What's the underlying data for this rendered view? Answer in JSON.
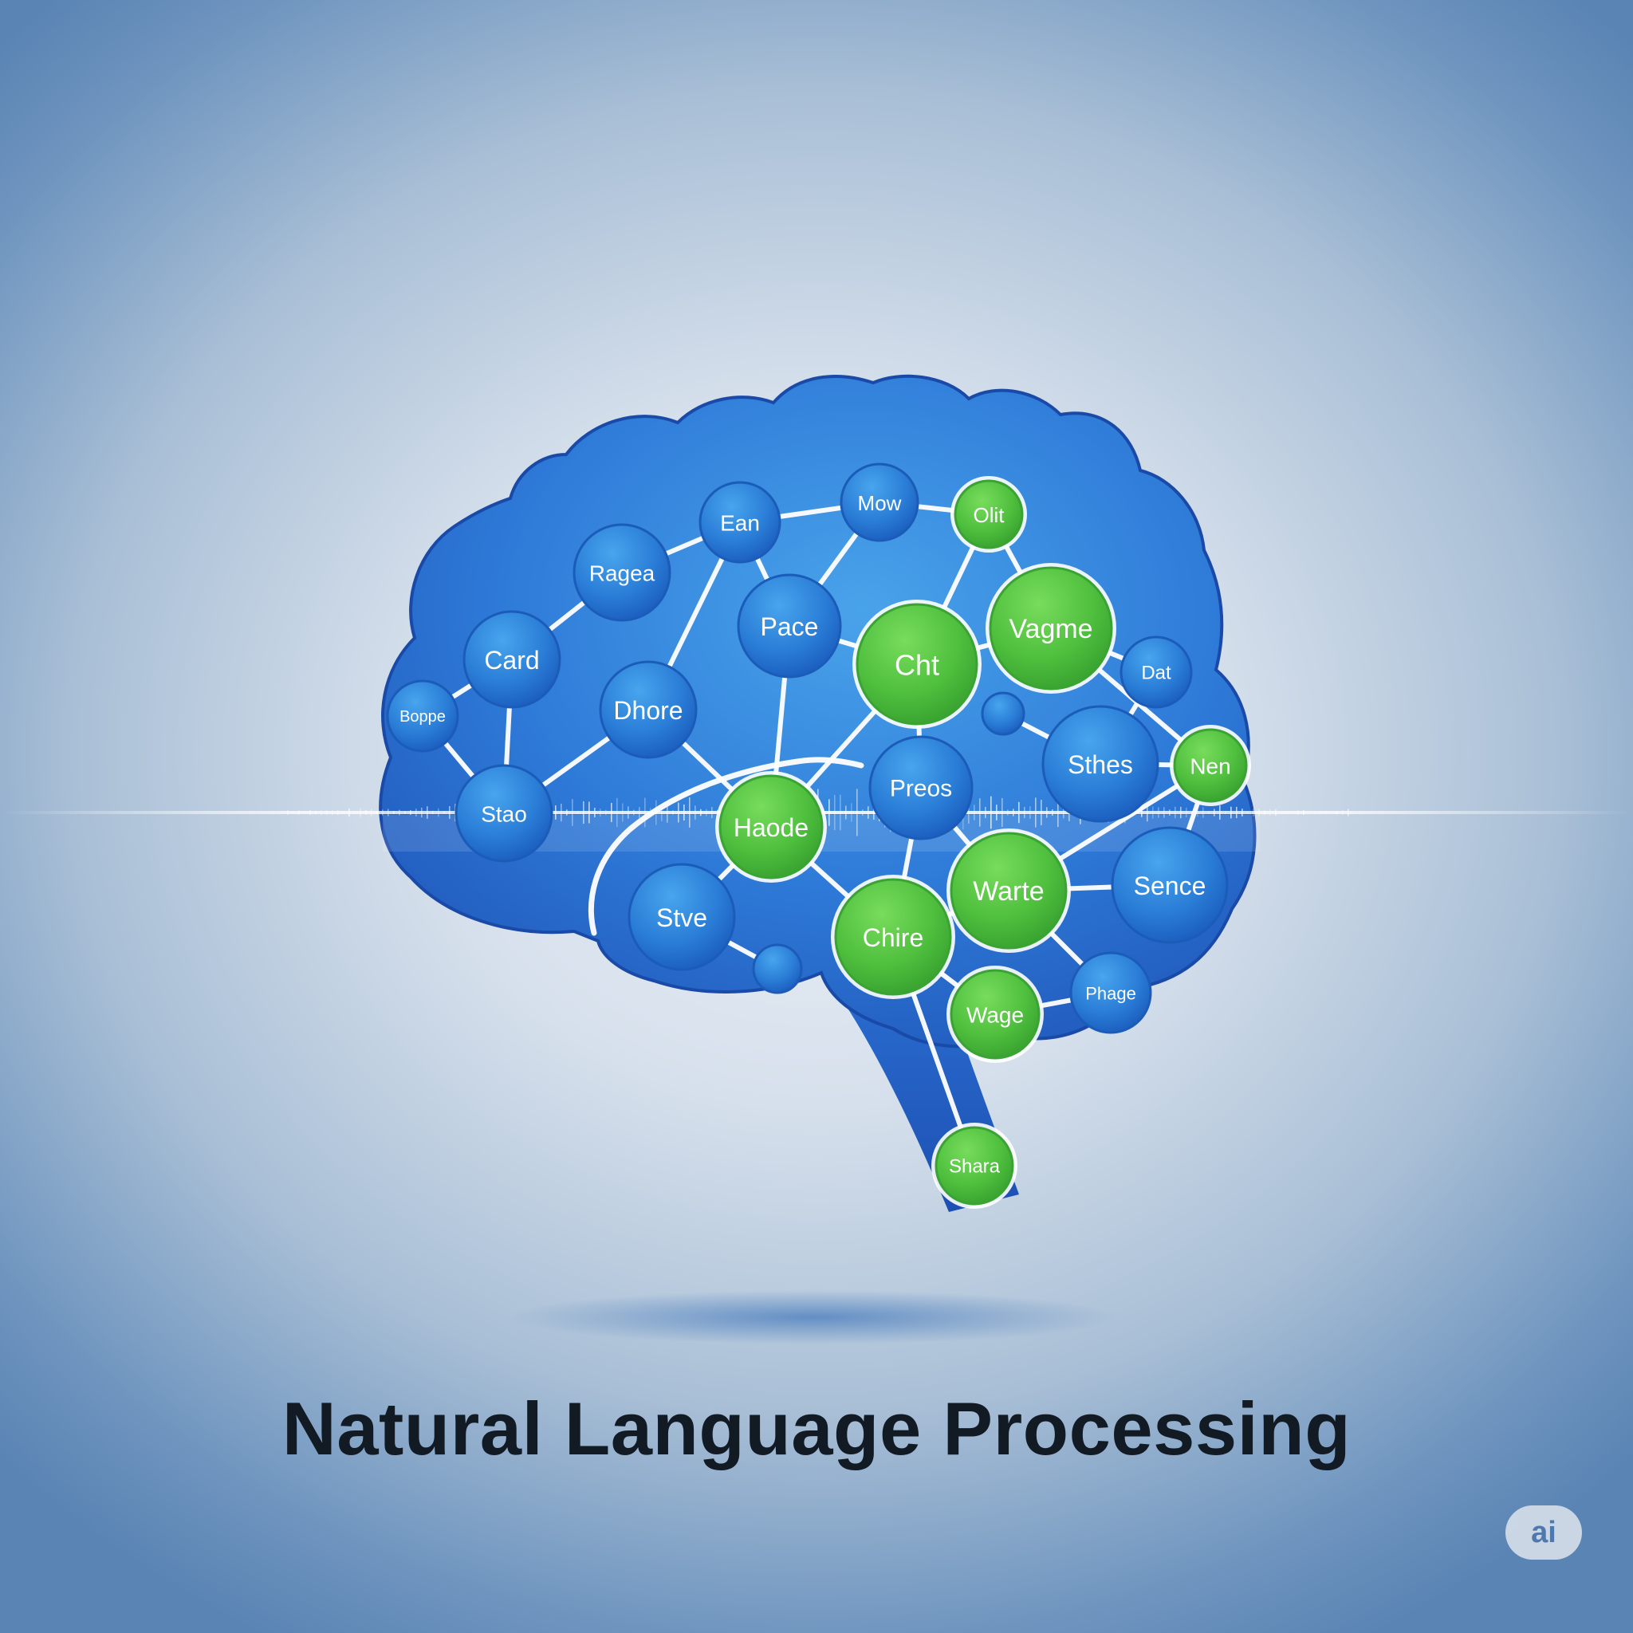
{
  "caption": "Natural Language Processing",
  "badge": "ai",
  "colors": {
    "brain": "#2a73d6",
    "brain_dark": "#1e56b8",
    "node_blue": "#2a7fd8",
    "node_green": "#4fc03f",
    "link": "#ffffff",
    "caption": "#121a24"
  },
  "nodes": [
    {
      "id": "ean",
      "label": "Ean",
      "color": "blue"
    },
    {
      "id": "mow",
      "label": "Mow",
      "color": "blue"
    },
    {
      "id": "olit",
      "label": "Olit",
      "color": "green"
    },
    {
      "id": "ragea",
      "label": "Ragea",
      "color": "blue"
    },
    {
      "id": "pace",
      "label": "Pace",
      "color": "blue"
    },
    {
      "id": "vagme",
      "label": "Vagme",
      "color": "green"
    },
    {
      "id": "card",
      "label": "Card",
      "color": "blue"
    },
    {
      "id": "cht",
      "label": "Cht",
      "color": "green"
    },
    {
      "id": "dat",
      "label": "Dat",
      "color": "blue"
    },
    {
      "id": "boppe",
      "label": "Boppe",
      "color": "blue"
    },
    {
      "id": "dhore",
      "label": "Dhore",
      "color": "blue"
    },
    {
      "id": "small1",
      "label": "",
      "color": "blue"
    },
    {
      "id": "sthes",
      "label": "Sthes",
      "color": "blue"
    },
    {
      "id": "nen",
      "label": "Nen",
      "color": "green"
    },
    {
      "id": "stao",
      "label": "Stao",
      "color": "blue"
    },
    {
      "id": "preos",
      "label": "Preos",
      "color": "blue"
    },
    {
      "id": "haode",
      "label": "Haode",
      "color": "green"
    },
    {
      "id": "warte",
      "label": "Warte",
      "color": "green"
    },
    {
      "id": "sence",
      "label": "Sence",
      "color": "blue"
    },
    {
      "id": "stve",
      "label": "Stve",
      "color": "blue"
    },
    {
      "id": "chire",
      "label": "Chire",
      "color": "green"
    },
    {
      "id": "small2",
      "label": "",
      "color": "blue"
    },
    {
      "id": "phage",
      "label": "Phage",
      "color": "blue"
    },
    {
      "id": "wage",
      "label": "Wage",
      "color": "green"
    },
    {
      "id": "shara",
      "label": "Shara",
      "color": "green"
    }
  ],
  "links": [
    [
      "boppe",
      "card"
    ],
    [
      "card",
      "ragea"
    ],
    [
      "ragea",
      "ean"
    ],
    [
      "ean",
      "mow"
    ],
    [
      "mow",
      "olit"
    ],
    [
      "ean",
      "pace"
    ],
    [
      "ean",
      "dhore"
    ],
    [
      "mow",
      "pace"
    ],
    [
      "olit",
      "vagme"
    ],
    [
      "olit",
      "cht"
    ],
    [
      "pace",
      "cht"
    ],
    [
      "cht",
      "vagme"
    ],
    [
      "vagme",
      "dat"
    ],
    [
      "vagme",
      "nen"
    ],
    [
      "dat",
      "sthes"
    ],
    [
      "small1",
      "sthes"
    ],
    [
      "sthes",
      "nen"
    ],
    [
      "cht",
      "preos"
    ],
    [
      "cht",
      "haode"
    ],
    [
      "pace",
      "haode"
    ],
    [
      "nen",
      "warte"
    ],
    [
      "nen",
      "sence"
    ],
    [
      "preos",
      "warte"
    ],
    [
      "warte",
      "sence"
    ],
    [
      "warte",
      "chire"
    ],
    [
      "haode",
      "chire"
    ],
    [
      "haode",
      "stve"
    ],
    [
      "haode",
      "dhore"
    ],
    [
      "dhore",
      "stao"
    ],
    [
      "card",
      "stao"
    ],
    [
      "boppe",
      "stao"
    ],
    [
      "stve",
      "small2"
    ],
    [
      "chire",
      "wage"
    ],
    [
      "wage",
      "phage"
    ],
    [
      "warte",
      "phage"
    ],
    [
      "chire",
      "shara"
    ],
    [
      "preos",
      "chire"
    ]
  ]
}
